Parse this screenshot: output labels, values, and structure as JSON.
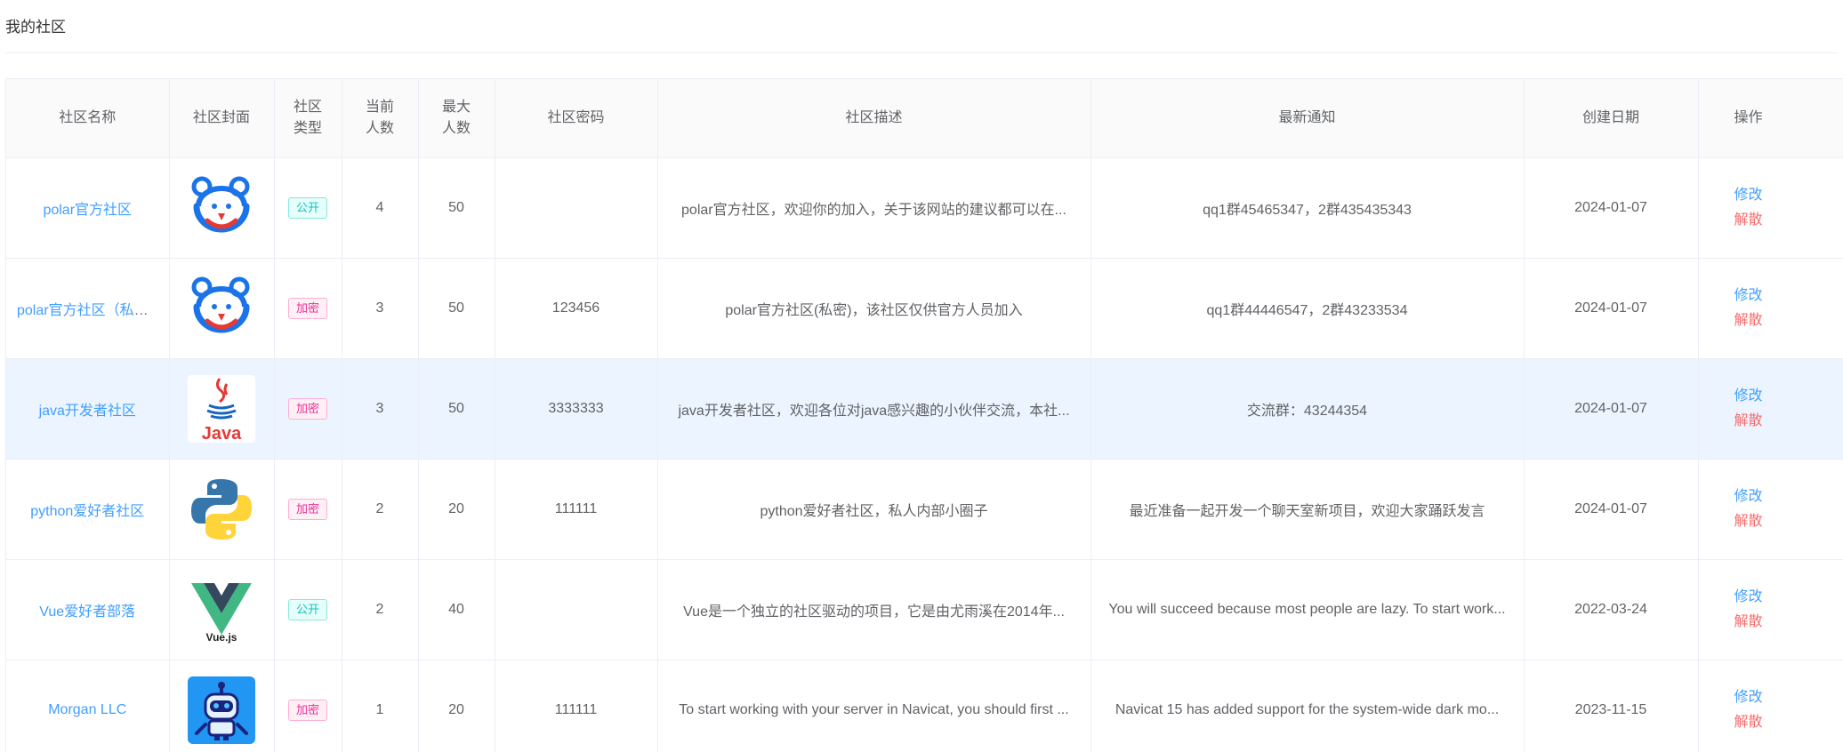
{
  "page": {
    "title": "我的社区"
  },
  "table": {
    "headers": {
      "name": "社区名称",
      "cover": "社区封面",
      "type": "社区类型",
      "current": "当前人数",
      "max": "最大人数",
      "password": "社区密码",
      "desc": "社区描述",
      "notice": "最新通知",
      "date": "创建日期",
      "ops": "操作"
    },
    "rows": [
      {
        "name": "polar官方社区",
        "cover": "bear-logo",
        "type": "公开",
        "type_style": "public",
        "current": "4",
        "max": "50",
        "password": "",
        "desc": "polar官方社区，欢迎你的加入，关于该网站的建议都可以在...",
        "notice": "qq1群45465347，2群435435343",
        "date": "2024-01-07",
        "edit": "修改",
        "dissolve": "解散"
      },
      {
        "name": "polar官方社区（私密）",
        "cover": "bear-logo",
        "type": "加密",
        "type_style": "secret",
        "current": "3",
        "max": "50",
        "password": "123456",
        "desc": "polar官方社区(私密)，该社区仅供官方人员加入",
        "notice": "qq1群44446547，2群43233534",
        "date": "2024-01-07",
        "edit": "修改",
        "dissolve": "解散"
      },
      {
        "name": "java开发者社区",
        "cover": "java-logo",
        "type": "加密",
        "type_style": "secret",
        "current": "3",
        "max": "50",
        "password": "3333333",
        "desc": "java开发者社区，欢迎各位对java感兴趣的小伙伴交流，本社...",
        "notice": "交流群：43244354",
        "date": "2024-01-07",
        "edit": "修改",
        "dissolve": "解散",
        "cover_text": "Java"
      },
      {
        "name": "python爱好者社区",
        "cover": "python-logo",
        "type": "加密",
        "type_style": "secret",
        "current": "2",
        "max": "20",
        "password": "111111",
        "desc": "python爱好者社区，私人内部小圈子",
        "notice": "最近准备一起开发一个聊天室新项目，欢迎大家踊跃发言",
        "date": "2024-01-07",
        "edit": "修改",
        "dissolve": "解散"
      },
      {
        "name": "Vue爱好者部落",
        "cover": "vue-logo",
        "type": "公开",
        "type_style": "public",
        "current": "2",
        "max": "40",
        "password": "",
        "desc": "Vue是一个独立的社区驱动的项目，它是由尤雨溪在2014年...",
        "notice": "You will succeed because most people are lazy. To start work...",
        "date": "2022-03-24",
        "edit": "修改",
        "dissolve": "解散",
        "cover_text": "Vue.js"
      },
      {
        "name": "Morgan LLC",
        "cover": "robot-logo",
        "type": "加密",
        "type_style": "secret",
        "current": "1",
        "max": "20",
        "password": "111111",
        "desc": "To start working with your server in Navicat, you should first ...",
        "notice": "Navicat 15 has added support for the system-wide dark mo...",
        "date": "2023-11-15",
        "edit": "修改",
        "dissolve": "解散"
      }
    ],
    "highlighted_row": 2
  },
  "colors": {
    "link": "#409eff",
    "danger": "#f56c6c",
    "tag_public": "#13c2c2",
    "tag_secret": "#eb2f96",
    "row_highlight": "#ecf5ff"
  }
}
